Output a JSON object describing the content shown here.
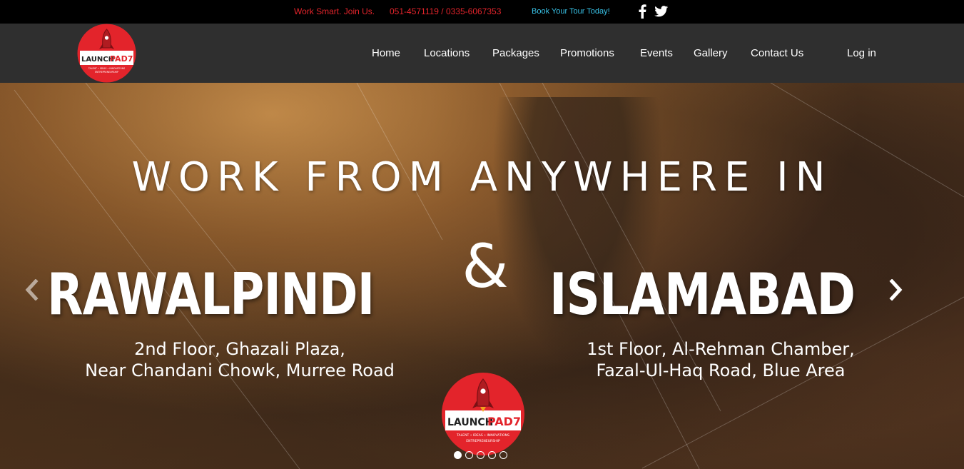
{
  "topbar": {
    "promo": "Work Smart. Join Us.",
    "phones": "051-4571119 / 0335-6067353",
    "tour_link": "Book Your Tour Today!",
    "facebook_icon": "facebook-icon",
    "twitter_icon": "twitter-icon"
  },
  "brand": {
    "name_left": "LAUNCH",
    "name_right": "PAD7",
    "tagline": "TALENT • IDEAS • INNOVATIONS",
    "tagline2": "ENTREPRENEURSHIP",
    "colors": {
      "red": "#e3242b",
      "nav_bg": "#2f2f2f",
      "topbar_bg": "#000000",
      "link_blue": "#39c3e8"
    }
  },
  "nav": {
    "items": [
      {
        "label": "Home"
      },
      {
        "label": "Locations"
      },
      {
        "label": "Packages"
      },
      {
        "label": "Promotions"
      },
      {
        "label": "Events"
      },
      {
        "label": "Gallery"
      },
      {
        "label": "Contact Us"
      }
    ],
    "login": "Log in"
  },
  "hero": {
    "headline": "WORK FROM ANYWHERE IN",
    "amp": "&",
    "left_city": "RAWALPINDI",
    "left_address_1": "2nd Floor, Ghazali Plaza,",
    "left_address_2": "Near Chandani Chowk, Murree Road",
    "right_city": "ISLAMABAD",
    "right_address_1": "1st Floor, Al-Rehman Chamber,",
    "right_address_2": "Fazal-Ul-Haq Road, Blue Area",
    "slides_total": 5,
    "active_slide": 1
  }
}
